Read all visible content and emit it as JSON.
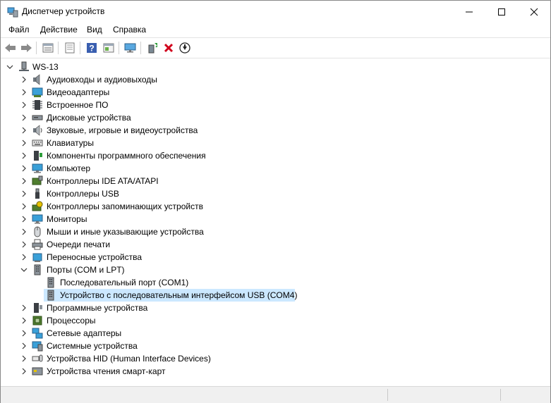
{
  "window": {
    "title": "Диспетчер устройств"
  },
  "menu": [
    "Файл",
    "Действие",
    "Вид",
    "Справка"
  ],
  "toolbar": {
    "buttons": [
      "back-icon",
      "forward-icon",
      "properties-list-icon",
      "properties-icon",
      "help-icon",
      "show-hidden-icon",
      "scan-hardware-icon",
      "update-driver-icon",
      "uninstall-icon",
      "disable-icon"
    ]
  },
  "tree": {
    "root": "WS-13",
    "categories": [
      {
        "label": "Аудиовходы и аудиовыходы",
        "icon": "speaker-icon"
      },
      {
        "label": "Видеоадаптеры",
        "icon": "display-adapter-icon"
      },
      {
        "label": "Встроенное ПО",
        "icon": "firmware-icon"
      },
      {
        "label": "Дисковые устройства",
        "icon": "disk-drive-icon"
      },
      {
        "label": "Звуковые, игровые и видеоустройства",
        "icon": "sound-icon"
      },
      {
        "label": "Клавиатуры",
        "icon": "keyboard-icon"
      },
      {
        "label": "Компоненты программного обеспечения",
        "icon": "software-component-icon"
      },
      {
        "label": "Компьютер",
        "icon": "computer-icon"
      },
      {
        "label": "Контроллеры IDE ATA/ATAPI",
        "icon": "ide-controller-icon"
      },
      {
        "label": "Контроллеры USB",
        "icon": "usb-icon"
      },
      {
        "label": "Контроллеры запоминающих устройств",
        "icon": "storage-controller-icon"
      },
      {
        "label": "Мониторы",
        "icon": "monitor-icon"
      },
      {
        "label": "Мыши и иные указывающие устройства",
        "icon": "mouse-icon"
      },
      {
        "label": "Очереди печати",
        "icon": "printer-icon"
      },
      {
        "label": "Переносные устройства",
        "icon": "portable-device-icon"
      },
      {
        "label": "Порты (COM и LPT)",
        "icon": "port-icon",
        "expanded": true
      },
      {
        "label": "Программные устройства",
        "icon": "software-device-icon"
      },
      {
        "label": "Процессоры",
        "icon": "processor-icon"
      },
      {
        "label": "Сетевые адаптеры",
        "icon": "network-adapter-icon"
      },
      {
        "label": "Системные устройства",
        "icon": "system-device-icon"
      },
      {
        "label": "Устройства HID (Human Interface Devices)",
        "icon": "hid-icon"
      },
      {
        "label": "Устройства чтения смарт-карт",
        "icon": "smart-card-icon"
      }
    ],
    "ports_children": [
      {
        "label": "Последовательный порт (COM1)",
        "icon": "port-icon"
      },
      {
        "label": "Устройство с последовательным интерфейсом USB (COM4)",
        "icon": "port-icon",
        "selected": true
      }
    ]
  },
  "colors": {
    "selection": "#cce8ff",
    "toolbar_red_x": "#d0021b",
    "green_arrow": "#2e9e3a",
    "help_blue": "#3a5fb0"
  }
}
